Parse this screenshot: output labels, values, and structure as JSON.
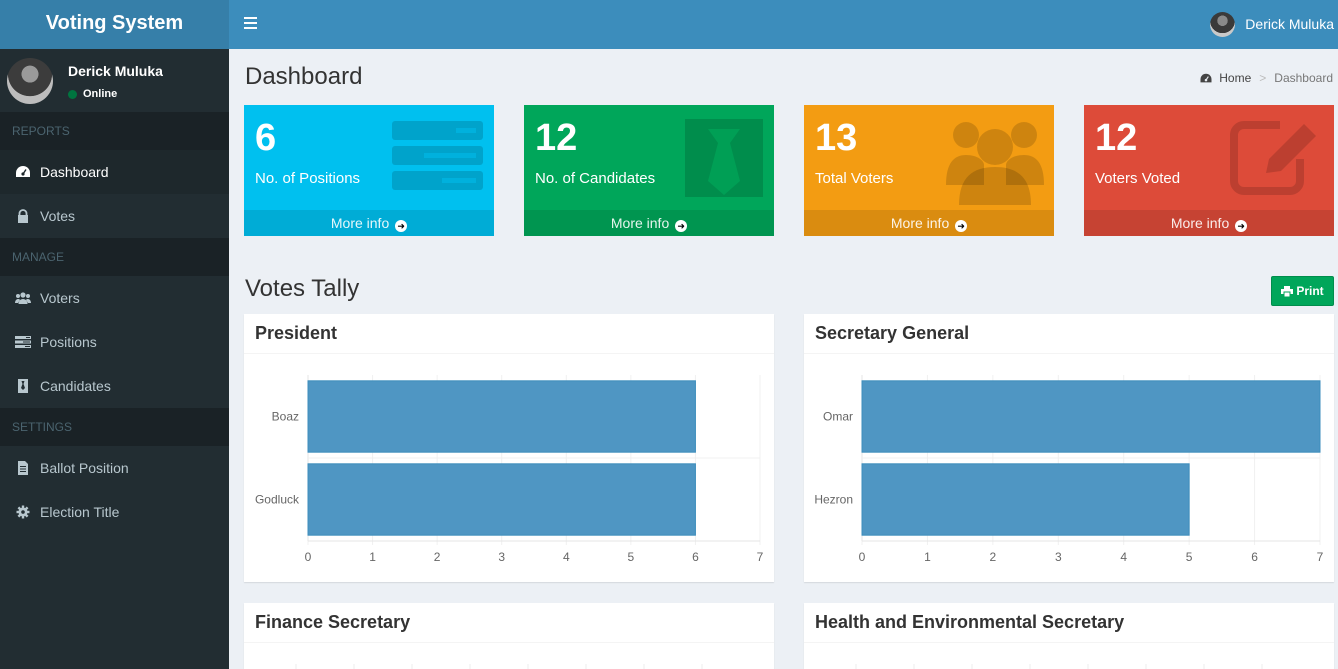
{
  "app": {
    "title": "Voting System"
  },
  "navbar": {
    "user_name": "Derick Muluka"
  },
  "sidebar": {
    "user": {
      "name": "Derick Muluka",
      "status": "Online"
    },
    "sections": [
      {
        "header": "REPORTS",
        "items": [
          {
            "label": "Dashboard",
            "icon": "dashboard-icon",
            "active": true
          },
          {
            "label": "Votes",
            "icon": "lock-icon"
          }
        ]
      },
      {
        "header": "MANAGE",
        "items": [
          {
            "label": "Voters",
            "icon": "users-icon"
          },
          {
            "label": "Positions",
            "icon": "tasks-icon"
          },
          {
            "label": "Candidates",
            "icon": "id-card-icon"
          }
        ]
      },
      {
        "header": "SETTINGS",
        "items": [
          {
            "label": "Ballot Position",
            "icon": "file-icon"
          },
          {
            "label": "Election Title",
            "icon": "cog-icon"
          }
        ]
      }
    ]
  },
  "page": {
    "title": "Dashboard",
    "breadcrumb": {
      "home": "Home",
      "current": "Dashboard"
    }
  },
  "stats": [
    {
      "value": "6",
      "label": "No. of Positions",
      "more": "More info",
      "color": "#00c0ef",
      "icon": "tasks-icon"
    },
    {
      "value": "12",
      "label": "No. of Candidates",
      "more": "More info",
      "color": "#00a65a",
      "icon": "id-badge-icon"
    },
    {
      "value": "13",
      "label": "Total Voters",
      "more": "More info",
      "color": "#f39c12",
      "icon": "users-icon"
    },
    {
      "value": "12",
      "label": "Voters Voted",
      "more": "More info",
      "color": "#dd4b39",
      "icon": "edit-icon"
    }
  ],
  "tally": {
    "title": "Votes Tally",
    "print_label": "Print"
  },
  "chart_data": [
    {
      "type": "bar",
      "orientation": "horizontal",
      "title": "President",
      "categories": [
        "Boaz",
        "Godluck"
      ],
      "values": [
        6,
        6
      ],
      "xlim": [
        0,
        7
      ],
      "ticks": [
        "0",
        "1",
        "2",
        "3",
        "4",
        "5",
        "6",
        "7"
      ],
      "color": "#4f96c3"
    },
    {
      "type": "bar",
      "orientation": "horizontal",
      "title": "Secretary General",
      "categories": [
        "Omar",
        "Hezron"
      ],
      "values": [
        7,
        5
      ],
      "xlim": [
        0,
        7
      ],
      "ticks": [
        "0",
        "1",
        "2",
        "3",
        "4",
        "5",
        "6",
        "7"
      ],
      "color": "#4f96c3"
    },
    {
      "type": "bar",
      "orientation": "horizontal",
      "title": "Finance Secretary",
      "categories": [],
      "values": []
    },
    {
      "type": "bar",
      "orientation": "horizontal",
      "title": "Health and Environmental Secretary",
      "categories": [],
      "values": []
    }
  ]
}
